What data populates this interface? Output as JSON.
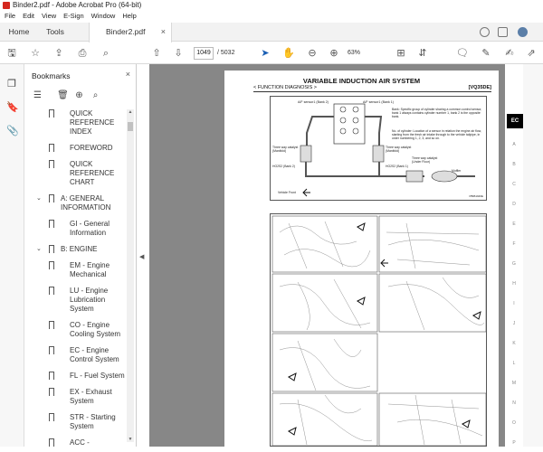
{
  "window": {
    "title": "Binder2.pdf - Adobe Acrobat Pro (64-bit)"
  },
  "menu": [
    "File",
    "Edit",
    "View",
    "E-Sign",
    "Window",
    "Help"
  ],
  "tabs": {
    "home": "Home",
    "tools": "Tools",
    "document": "Binder2.pdf"
  },
  "toolbar": {
    "current_page": "1049",
    "total_pages": "/ 5032",
    "zoom": "63%"
  },
  "bookmarks": {
    "title": "Bookmarks",
    "items": [
      {
        "label": "QUICK REFERENCE INDEX",
        "level": 1
      },
      {
        "label": "FOREWORD",
        "level": 1
      },
      {
        "label": "QUICK REFERENCE CHART",
        "level": 1
      },
      {
        "label": "A: GENERAL INFORMATION",
        "level": 0,
        "expanded": true
      },
      {
        "label": "GI - General Information",
        "level": 1
      },
      {
        "label": "B: ENGINE",
        "level": 0,
        "expanded": true
      },
      {
        "label": "EM - Engine Mechanical",
        "level": 1
      },
      {
        "label": "LU - Engine Lubrication System",
        "level": 1
      },
      {
        "label": "CO - Engine Cooling System",
        "level": 1
      },
      {
        "label": "EC - Engine Control System",
        "level": 1
      },
      {
        "label": "FL - Fuel System",
        "level": 1
      },
      {
        "label": "EX - Exhaust System",
        "level": 1
      },
      {
        "label": "STR - Starting System",
        "level": 1
      },
      {
        "label": "ACC - Accelerator Control System",
        "level": 1
      }
    ]
  },
  "document": {
    "title": "VARIABLE INDUCTION AIR SYSTEM",
    "section": "< FUNCTION DIAGNOSIS >",
    "code": "[VQ35DE]",
    "diagram_labels": {
      "af_sensor_2": "A/F sensor1 (Bank 2)",
      "af_sensor_1": "A/F sensor1 (Bank 1)",
      "bank_note": "Bank: Specific group of cylinder sharing a common control sensor, bank 1 always contains cylinder number 1, bank 2 is the opposite bank.",
      "cyl_note": "No. of cylinder: Location of a sensor in relation the engine air flow, starting from the fresh air intake through to the vehicle tailpipe, in order numbering 1, 2, 3, and so on.",
      "cat_left": "Three way catalyst (Manifold)",
      "cat_right": "Three way catalyst (Manifold)",
      "ho2s2_left": "HO2S2 (Bank 2)",
      "ho2s2_right": "HO2S2 (Bank 1)",
      "cat_under": "Three way catalyst (Under Floor)",
      "muffler": "Muffler",
      "vehicle_front": "Vehicle Front",
      "ref": "PBIB1946E"
    },
    "side_index_active": "EC",
    "side_index_letters": [
      "A",
      "B",
      "C",
      "D",
      "E",
      "F",
      "G",
      "H",
      "I",
      "J",
      "K",
      "L",
      "M",
      "N",
      "O",
      "P"
    ]
  }
}
